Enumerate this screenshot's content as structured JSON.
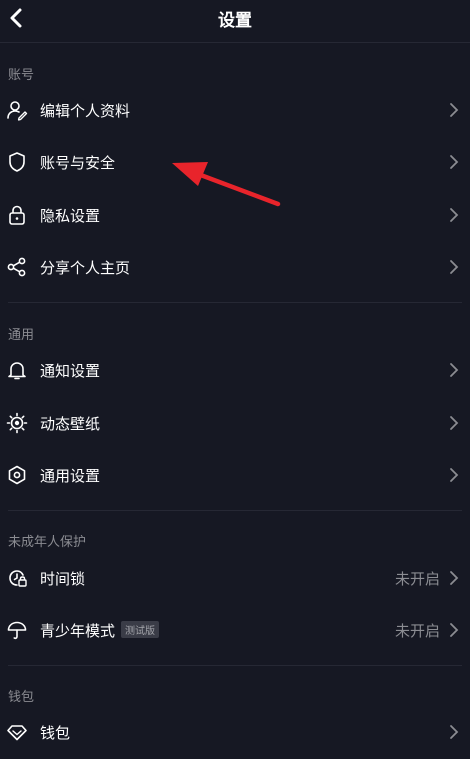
{
  "header": {
    "title": "设置"
  },
  "sections": {
    "account": {
      "label": "账号",
      "items": [
        {
          "label": "编辑个人资料"
        },
        {
          "label": "账号与安全"
        },
        {
          "label": "隐私设置"
        },
        {
          "label": "分享个人主页"
        }
      ]
    },
    "general": {
      "label": "通用",
      "items": [
        {
          "label": "通知设置"
        },
        {
          "label": "动态壁纸"
        },
        {
          "label": "通用设置"
        }
      ]
    },
    "minor": {
      "label": "未成年人保护",
      "items": [
        {
          "label": "时间锁",
          "value": "未开启"
        },
        {
          "label": "青少年模式",
          "badge": "测试版",
          "value": "未开启"
        }
      ]
    },
    "wallet": {
      "label": "钱包",
      "items": [
        {
          "label": "钱包"
        }
      ]
    }
  },
  "colors": {
    "background": "#161823",
    "text": "#ffffff",
    "muted": "#8b8c92",
    "annotation_arrow": "#e8242b"
  },
  "icons": {
    "back": "chevron-left-icon",
    "edit_profile": "user-edit-icon",
    "account_security": "shield-icon",
    "privacy": "lock-icon",
    "share": "share-icon",
    "notifications": "bell-icon",
    "wallpaper": "gear-sun-icon",
    "general_settings": "hexagon-icon",
    "time_lock": "clock-lock-icon",
    "teen_mode": "umbrella-icon",
    "wallet": "diamond-icon"
  }
}
